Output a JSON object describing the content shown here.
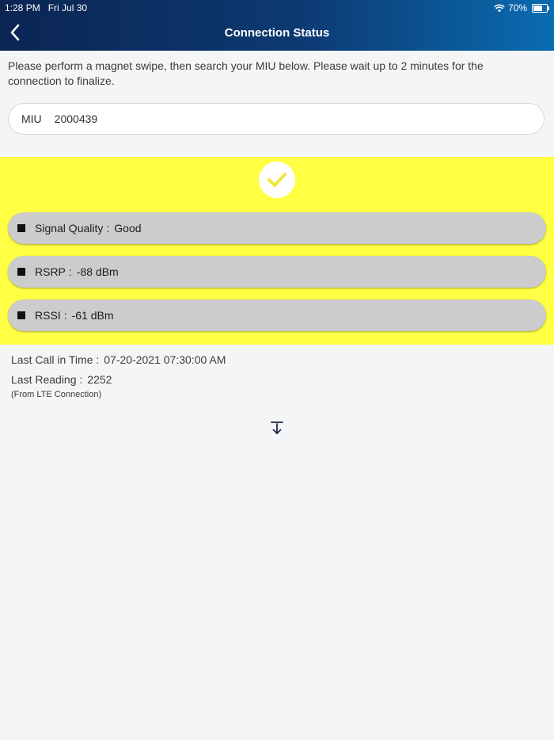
{
  "status_bar": {
    "time": "1:28 PM",
    "date": "Fri Jul 30",
    "battery_percent": "70%",
    "battery_level": 0.7,
    "wifi_icon": "wifi-icon"
  },
  "header": {
    "title": "Connection Status",
    "back_icon": "chevron-left-icon",
    "gradient": [
      "#0b2553",
      "#0a6cb0"
    ]
  },
  "instructions": "Please perform a magnet swipe, then search your MIU below. Please wait up to 2 minutes for the connection to finalize.",
  "search": {
    "label": "MIU",
    "value": "2000439"
  },
  "status_panel": {
    "background": "#ffff44",
    "icon": "checkmark-icon",
    "metrics": [
      {
        "label": "Signal Quality",
        "value": "Good"
      },
      {
        "label": "RSRP",
        "value": "-88 dBm"
      },
      {
        "label": "RSSI",
        "value": "-61 dBm"
      }
    ]
  },
  "details": {
    "last_call_label": "Last Call in Time :",
    "last_call_value": "07-20-2021 07:30:00 AM",
    "last_reading_label": "Last Reading :",
    "last_reading_value": "2252",
    "source_note": "(From LTE Connection)"
  },
  "actions": {
    "download_icon": "download-to-bottom-icon"
  }
}
